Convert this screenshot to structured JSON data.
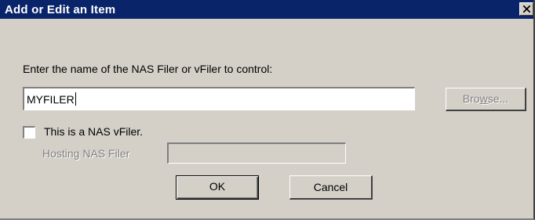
{
  "window": {
    "title": "Add or Edit an Item",
    "close_label": "✕"
  },
  "form": {
    "prompt": "Enter the name of the NAS Filer or vFiler to control:",
    "filer_name_value": "MYFILER",
    "browse_label_pre": "Bro",
    "browse_label_underline": "w",
    "browse_label_post": "se...",
    "vfiler_checkbox_label": "This is a NAS vFiler.",
    "vfiler_checked": false,
    "hosting_label": "Hosting NAS Filer",
    "hosting_value": ""
  },
  "buttons": {
    "ok_label": "OK",
    "cancel_label": "Cancel"
  },
  "colors": {
    "titlebar": "#0a246a",
    "face": "#d4d0c8",
    "disabled_text": "#808080"
  }
}
